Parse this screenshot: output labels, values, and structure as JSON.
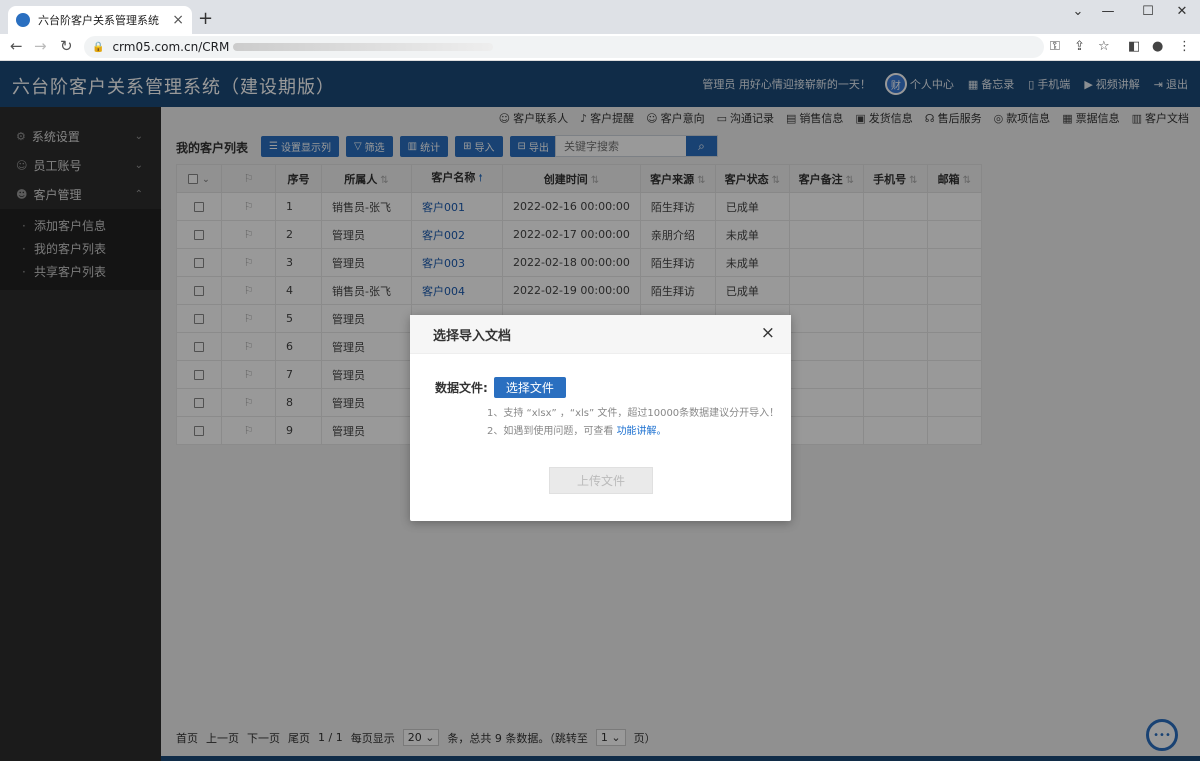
{
  "browser": {
    "tab_title": "六台阶客户关系管理系统（建设期版）",
    "new_tab": "+",
    "url": "crm05.com.cn/CRM"
  },
  "header": {
    "title": "六台阶客户关系管理系统（建设期版）",
    "greeting": "管理员 用好心情迎接崭新的一天！",
    "avatar_text": "财",
    "items": [
      "个人中心",
      "备忘录",
      "手机端",
      "视频讲解",
      "退出"
    ]
  },
  "sidebar": {
    "groups": [
      {
        "label": "系统设置"
      },
      {
        "label": "员工账号"
      },
      {
        "label": "客户管理"
      }
    ],
    "sub_items": [
      "添加客户信息",
      "我的客户列表",
      "共享客户列表"
    ]
  },
  "quicknav": [
    "客户联系人",
    "客户提醒",
    "客户意向",
    "沟通记录",
    "销售信息",
    "发货信息",
    "售后服务",
    "款项信息",
    "票据信息",
    "客户文档"
  ],
  "list": {
    "title": "我的客户列表",
    "toolbar": [
      "设置显示列",
      "筛选",
      "统计",
      "导入",
      "导出"
    ],
    "search_placeholder": "关键字搜索"
  },
  "table": {
    "headers": [
      "序号",
      "所属人",
      "客户名称",
      "创建时间",
      "客户来源",
      "客户状态",
      "客户备注",
      "手机号",
      "邮箱"
    ],
    "rows": [
      {
        "no": "1",
        "owner": "销售员-张飞",
        "name": "客户001",
        "created": "2022-02-16 00:00:00",
        "source": "陌生拜访",
        "status": "已成单"
      },
      {
        "no": "2",
        "owner": "管理员",
        "name": "客户002",
        "created": "2022-02-17 00:00:00",
        "source": "亲朋介绍",
        "status": "未成单"
      },
      {
        "no": "3",
        "owner": "管理员",
        "name": "客户003",
        "created": "2022-02-18 00:00:00",
        "source": "陌生拜访",
        "status": "未成单"
      },
      {
        "no": "4",
        "owner": "销售员-张飞",
        "name": "客户004",
        "created": "2022-02-19 00:00:00",
        "source": "陌生拜访",
        "status": "已成单"
      },
      {
        "no": "5",
        "owner": "管理员",
        "name": "",
        "created": "",
        "source": "",
        "status": ""
      },
      {
        "no": "6",
        "owner": "管理员",
        "name": "",
        "created": "",
        "source": "",
        "status": ""
      },
      {
        "no": "7",
        "owner": "管理员",
        "name": "",
        "created": "",
        "source": "",
        "status": ""
      },
      {
        "no": "8",
        "owner": "管理员",
        "name": "",
        "created": "",
        "source": "",
        "status": ""
      },
      {
        "no": "9",
        "owner": "管理员",
        "name": "",
        "created": "",
        "source": "",
        "status": ""
      }
    ]
  },
  "pager": {
    "first": "首页",
    "prev": "上一页",
    "next": "下一页",
    "last": "尾页",
    "page_info": "1 / 1",
    "per_page_label": "每页显示",
    "per_page": "20",
    "summary": "条，总共 9 条数据。（跳转至",
    "jump_page": "1",
    "page_suffix": "页）"
  },
  "modal": {
    "title": "选择导入文档",
    "close": "×",
    "file_label": "数据文件:",
    "choose_button": "选择文件",
    "tip1": "1、支持 “xlsx” ，“xls” 文件，超过10000条数据建议分开导入！",
    "tip2_prefix": "2、如遇到使用问题，可查看",
    "tip2_link": "功能讲解。",
    "upload_button": "上传文件"
  },
  "colors": {
    "brand": "#1c4a78",
    "accent": "#2a6fc0",
    "sidebar": "#2d2d2d"
  }
}
